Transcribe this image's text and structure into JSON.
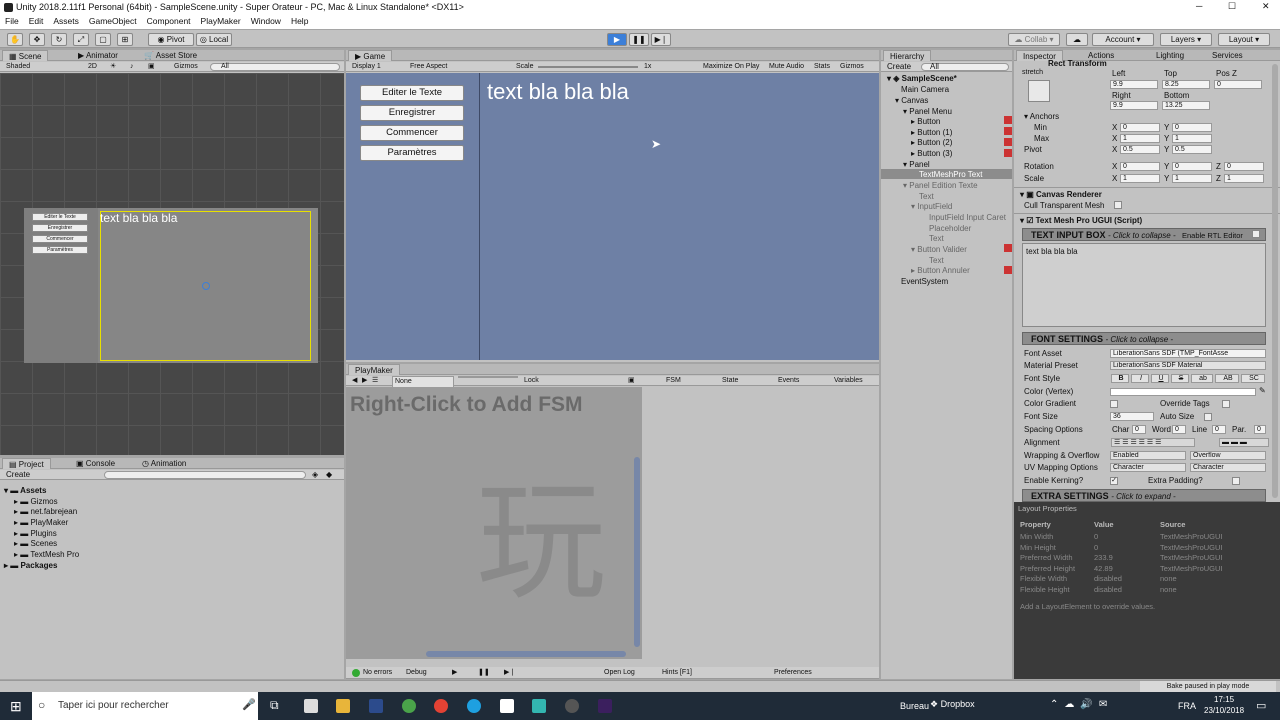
{
  "window": {
    "title": "Unity 2018.2.11f1 Personal (64bit) - SampleScene.unity - Super Orateur - PC, Mac & Linux Standalone* <DX11>"
  },
  "menu": [
    "File",
    "Edit",
    "Assets",
    "GameObject",
    "Component",
    "PlayMaker",
    "Window",
    "Help"
  ],
  "toolbar": {
    "pivot": "Pivot",
    "local": "Local",
    "collab": "Collab",
    "account": "Account",
    "layers": "Layers",
    "layout": "Layout"
  },
  "scene": {
    "tabs": [
      "Scene",
      "Animator",
      "Asset Store"
    ],
    "shaded": "Shaded",
    "mode2d": "2D",
    "gizmos": "Gizmos",
    "search": "All",
    "text": "text bla bla bla",
    "buttons": [
      "Editer le Texte",
      "Enregistrer",
      "Commencer",
      "Paramètres"
    ]
  },
  "game": {
    "tab": "Game",
    "display": "Display 1",
    "aspect": "Free Aspect",
    "scale": "Scale",
    "scale_value": "1x",
    "maximize": "Maximize On Play",
    "mute": "Mute Audio",
    "stats": "Stats",
    "gizmos": "Gizmos",
    "text": "text bla bla bla",
    "buttons": [
      "Editer le Texte",
      "Enregistrer",
      "Commencer",
      "Paramètres"
    ]
  },
  "hierarchy": {
    "tab": "Hierarchy",
    "create": "Create",
    "search": "All",
    "scene": "SampleScene*",
    "items": [
      "Main Camera",
      "Canvas",
      "Panel Menu",
      "Button",
      "Button (1)",
      "Button (2)",
      "Button (3)",
      "Panel",
      "TextMeshPro Text",
      "Panel Edition Texte",
      "Text",
      "InputField",
      "InputField Input Caret",
      "Placeholder",
      "Text",
      "Button Valider",
      "Text",
      "Button Annuler",
      "EventSystem"
    ]
  },
  "inspector": {
    "tabs": [
      "Inspector",
      "Actions",
      "Lighting",
      "Services"
    ],
    "component": "Rect Transform",
    "stretch": "stretch",
    "left_label": "Left",
    "top_label": "Top",
    "posz_label": "Pos Z",
    "left": "9.9",
    "top": "8.25",
    "posz": "0",
    "right_label": "Right",
    "bottom_label": "Bottom",
    "right": "9.9",
    "bottom": "13.25",
    "anchors": "Anchors",
    "min": "Min",
    "max": "Max",
    "pivot": "Pivot",
    "rotation": "Rotation",
    "scale": "Scale",
    "x": "X",
    "y": "Y",
    "z": "Z",
    "anchor_min_x": "0",
    "anchor_min_y": "0",
    "anchor_max_x": "1",
    "anchor_max_y": "1",
    "pivot_x": "0.5",
    "pivot_y": "0.5",
    "rot_x": "0",
    "rot_y": "0",
    "rot_z": "0",
    "scale_x": "1",
    "scale_y": "1",
    "scale_z": "1",
    "canvas_renderer": "Canvas Renderer",
    "cull": "Cull Transparent Mesh",
    "tmp": "Text Mesh Pro UGUI (Script)",
    "text_input": "TEXT INPUT BOX",
    "click_collapse": "- Click to collapse -",
    "rtl": "Enable RTL Editor",
    "text_value": "text bla bla bla",
    "font_settings": "FONT SETTINGS",
    "font_asset": "Font Asset",
    "font_asset_value": "LiberationSans SDF (TMP_FontAsse",
    "material_preset": "Material Preset",
    "material_value": "LiberationSans SDF Material",
    "font_style": "Font Style",
    "style_buttons": [
      "B",
      "I",
      "U",
      "S",
      "ab",
      "AB",
      "SC"
    ],
    "color_vertex": "Color (Vertex)",
    "color_gradient": "Color Gradient",
    "override_tags": "Override Tags",
    "font_size": "Font Size",
    "font_size_value": "36",
    "auto_size": "Auto Size",
    "spacing": "Spacing Options",
    "char": "Char",
    "char_value": "0",
    "word": "Word",
    "word_value": "0",
    "line": "Line",
    "line_value": "0",
    "par": "Par.",
    "par_value": "0",
    "alignment": "Alignment",
    "wrapping": "Wrapping & Overflow",
    "wrap_value": "Enabled",
    "overflow_value": "Overflow",
    "uv": "UV Mapping Options",
    "uv_value1": "Character",
    "uv_value2": "Character",
    "kerning": "Enable Kerning?",
    "extra_padding": "Extra Padding?",
    "extra_settings": "EXTRA SETTINGS",
    "click_expand": "- Click to expand -"
  },
  "layout_props": {
    "title": "Layout Properties",
    "headers": [
      "Property",
      "Value",
      "Source"
    ],
    "rows": [
      [
        "Min Width",
        "0",
        "TextMeshProUGUI"
      ],
      [
        "Min Height",
        "0",
        "TextMeshProUGUI"
      ],
      [
        "Preferred Width",
        "233.9",
        "TextMeshProUGUI"
      ],
      [
        "Preferred Height",
        "42.89",
        "TextMeshProUGUI"
      ],
      [
        "Flexible Width",
        "disabled",
        "none"
      ],
      [
        "Flexible Height",
        "disabled",
        "none"
      ]
    ],
    "note": "Add a LayoutElement to override values."
  },
  "project": {
    "tabs": [
      "Project",
      "Console",
      "Animation"
    ],
    "create": "Create",
    "assets": "Assets",
    "folders": [
      "Gizmos",
      "net.fabrejean",
      "PlayMaker",
      "Plugins",
      "Scenes",
      "TextMesh Pro"
    ],
    "packages": "Packages"
  },
  "playmaker": {
    "tab": "PlayMaker",
    "none": "None",
    "lock": "Lock",
    "fsm_tab": "FSM",
    "state_tab": "State",
    "events_tab": "Events",
    "variables_tab": "Variables",
    "hint": "Right-Click to Add FSM",
    "watermark": "玩",
    "no_errors": "No errors",
    "debug": "Debug",
    "open_log": "Open Log",
    "hints": "Hints [F1]",
    "preferences": "Preferences"
  },
  "status": {
    "bake": "Bake paused in play mode"
  },
  "taskbar": {
    "search": "Taper ici pour rechercher",
    "bureau": "Bureau",
    "dropbox": "Dropbox",
    "lang": "FRA",
    "time": "17:15",
    "date": "23/10/2018"
  }
}
